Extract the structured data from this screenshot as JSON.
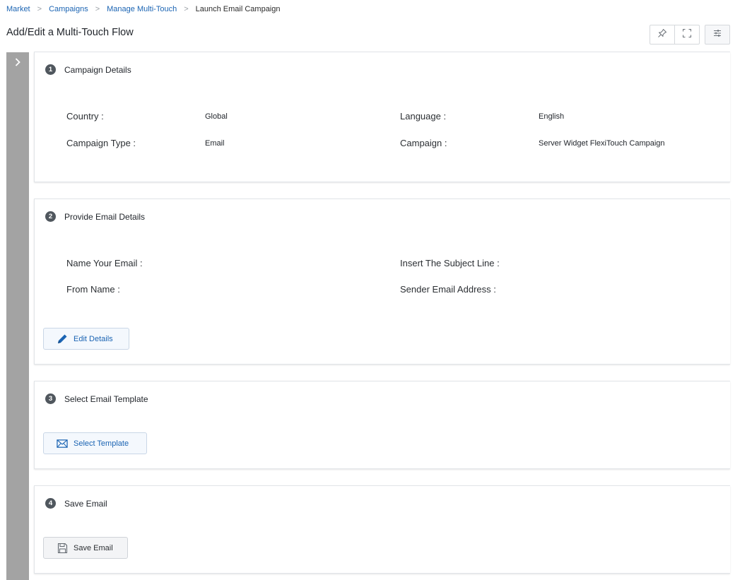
{
  "breadcrumb": {
    "items": [
      "Market",
      "Campaigns",
      "Manage Multi-Touch"
    ],
    "current": "Launch Email Campaign",
    "separator": ">"
  },
  "header": {
    "title": "Add/Edit a Multi-Touch Flow"
  },
  "toolbar": {
    "icons": [
      "pin-icon",
      "fullscreen-icon",
      "settings-sliders-icon"
    ]
  },
  "sidebar": {
    "toggle_icon": "chevron-right-icon"
  },
  "steps": {
    "campaign_details": {
      "number": "1",
      "title": "Campaign Details",
      "country_label": "Country :",
      "country_value": "Global",
      "language_label": "Language :",
      "language_value": "English",
      "campaign_type_label": "Campaign Type :",
      "campaign_type_value": "Email",
      "campaign_label": "Campaign :",
      "campaign_value": "Server Widget FlexiTouch Campaign"
    },
    "email_details": {
      "number": "2",
      "title": "Provide Email Details",
      "name_label": "Name Your Email :",
      "subject_label": "Insert The Subject Line :",
      "from_label": "From Name :",
      "sender_label": "Sender Email Address :",
      "edit_button": "Edit Details"
    },
    "email_template": {
      "number": "3",
      "title": "Select Email Template",
      "select_button": "Select Template"
    },
    "save_email": {
      "number": "4",
      "title": "Save Email",
      "save_button": "Save Email"
    }
  },
  "colors": {
    "link": "#1b64b3",
    "rail": "#a3a3a3",
    "step_badge": "#50575e",
    "button_bg": "#f4f8fd"
  }
}
